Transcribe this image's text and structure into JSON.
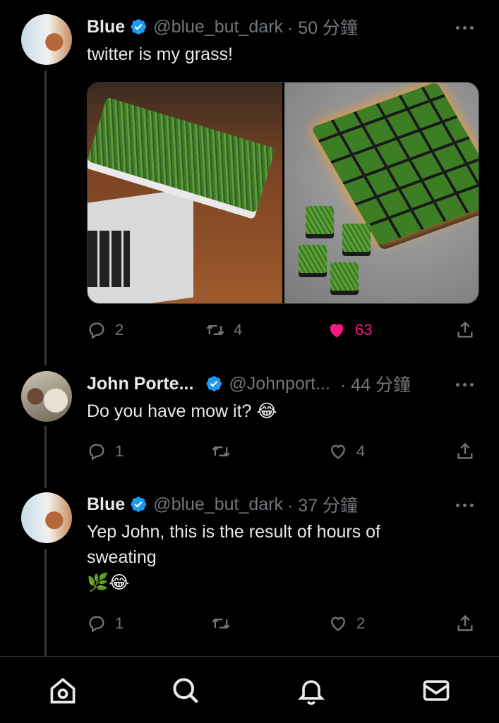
{
  "tweets": [
    {
      "name": "Blue",
      "handle": "@blue_but_dark",
      "time": "· 50 分鐘",
      "text": "twitter is my grass!",
      "actions": {
        "replies": "2",
        "retweets": "4",
        "likes": "63",
        "liked": true
      }
    },
    {
      "name": "John Porte...",
      "handle": "@Johnport...",
      "time": "· 44 分鐘",
      "text": "Do you have mow it? 😂",
      "actions": {
        "replies": "1",
        "retweets": "",
        "likes": "4",
        "liked": false
      }
    },
    {
      "name": "Blue",
      "handle": "@blue_but_dark",
      "time": "· 37 分鐘",
      "text_line1": "Yep John, this is the result of hours of",
      "text_line2": "sweating",
      "text_line3": "🌿😂",
      "actions": {
        "replies": "1",
        "retweets": "",
        "likes": "2",
        "liked": false
      }
    }
  ],
  "icons": {
    "verified": "verified-badge-icon",
    "more": "more-dots-icon",
    "reply": "reply-icon",
    "retweet": "retweet-icon",
    "like": "heart-icon",
    "share": "share-icon"
  },
  "nav": [
    "home-icon",
    "search-icon",
    "notifications-icon",
    "messages-icon"
  ],
  "colors": {
    "background": "#000000",
    "verified": "#1d9bf0",
    "like": "#f91880",
    "muted": "#71767b"
  }
}
